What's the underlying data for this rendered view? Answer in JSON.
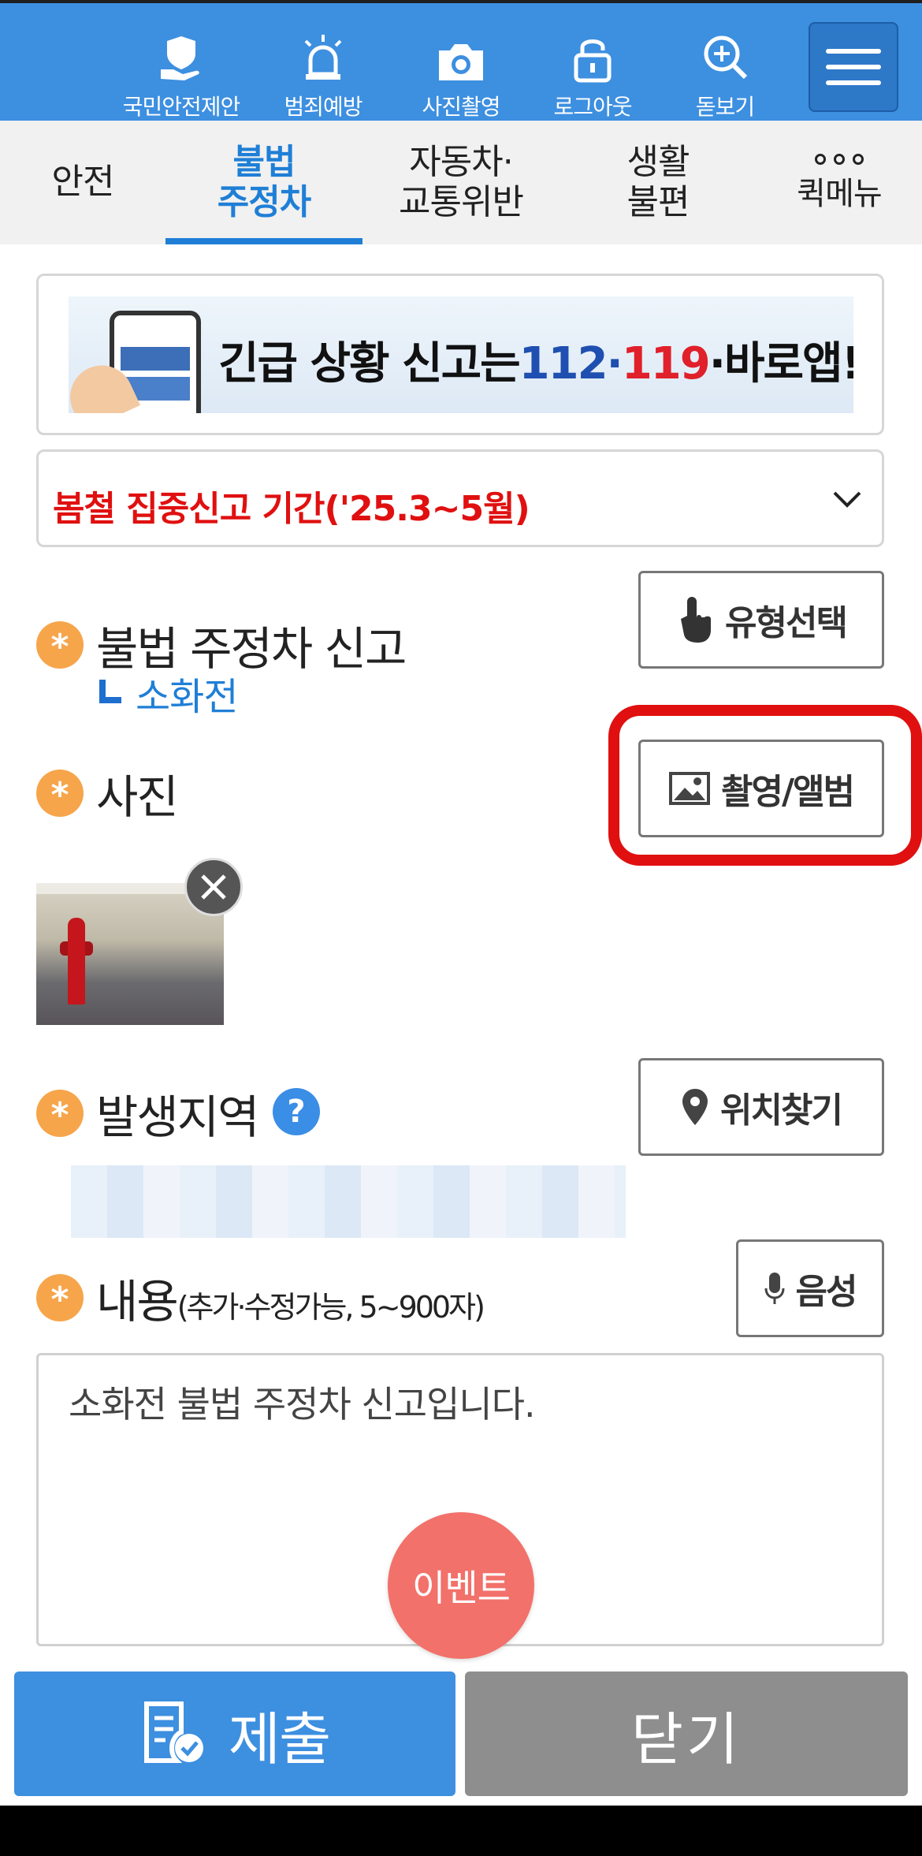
{
  "top_nav": {
    "items": [
      {
        "label": "국민안전제안",
        "icon": "safety-proposal-icon"
      },
      {
        "label": "범죄예방",
        "icon": "siren-icon"
      },
      {
        "label": "사진촬영",
        "icon": "camera-icon"
      },
      {
        "label": "로그아웃",
        "icon": "lock-icon"
      },
      {
        "label": "돋보기",
        "icon": "magnifier-icon"
      }
    ],
    "menu_icon": "hamburger-menu-icon"
  },
  "tabs": [
    {
      "line1": "안전",
      "line2": ""
    },
    {
      "line1": "불법",
      "line2": "주정차"
    },
    {
      "line1": "자동차·",
      "line2": "교통위반"
    },
    {
      "line1": "생활",
      "line2": "불편"
    },
    {
      "line1": "퀵메뉴",
      "line2": ""
    }
  ],
  "banner": {
    "text_prefix": "긴급 상황 신고는",
    "num1": "112",
    "dot1": "·",
    "num2": "119",
    "suffix": "·바로앱!"
  },
  "notice": {
    "text": "봄철 집중신고 기간('25.3~5월)"
  },
  "report_type": {
    "title": "불법 주정차 신고",
    "sub": "소화전",
    "button": "유형선택"
  },
  "photo": {
    "title": "사진",
    "button": "촬영/앨범"
  },
  "location": {
    "title": "발생지역",
    "help": "?",
    "button": "위치찾기"
  },
  "content": {
    "title": "내용",
    "hint": "(추가·수정가능, 5~900자)",
    "button": "음성",
    "value": "소화전 불법 주정차 신고입니다."
  },
  "event_button": "이벤트",
  "bottom": {
    "submit": "제출",
    "close": "닫기"
  },
  "required_mark": "*",
  "colors": {
    "primary": "#3d8fe0",
    "accent_blue": "#1f7fd6",
    "required": "#f6a54b",
    "notice_red": "#e01010",
    "event": "#f2716a",
    "close_gray": "#8e8e8e"
  }
}
